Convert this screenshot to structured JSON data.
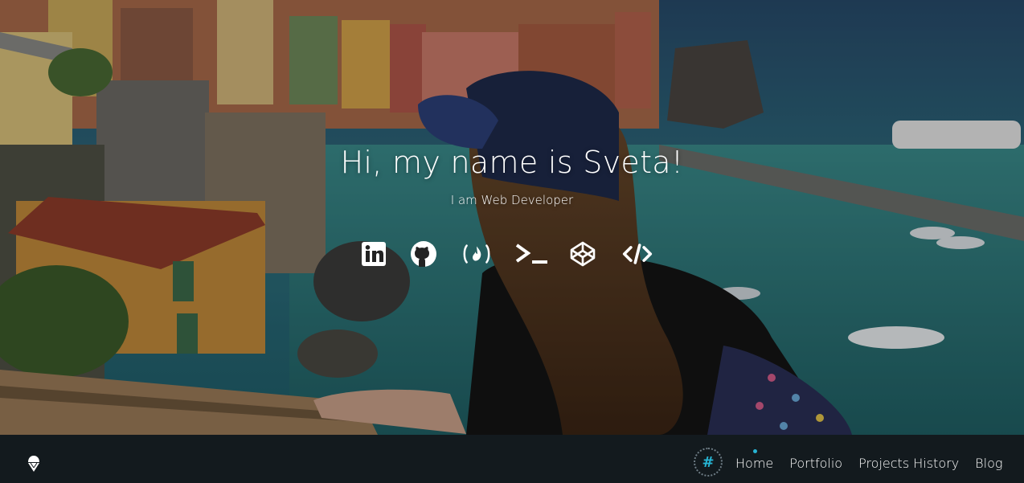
{
  "hero": {
    "title": "Hi, my name is Sveta!",
    "subtitle": "I am Web Developer"
  },
  "social_links": [
    {
      "name": "linkedin-icon"
    },
    {
      "name": "github-icon"
    },
    {
      "name": "freecodecamp-icon"
    },
    {
      "name": "terminal-icon"
    },
    {
      "name": "codepen-icon"
    },
    {
      "name": "code-icon"
    }
  ],
  "navbar": {
    "brand_icon": "ice-cream-icon",
    "hash_symbol": "#",
    "items": [
      {
        "label": "Home"
      },
      {
        "label": "Portfolio"
      },
      {
        "label": "Projects History"
      },
      {
        "label": "Blog"
      }
    ],
    "active_index": 0
  },
  "colors": {
    "accent": "#27b4d3",
    "navbar_bg": "#131a1e",
    "text": "#ffffff"
  }
}
